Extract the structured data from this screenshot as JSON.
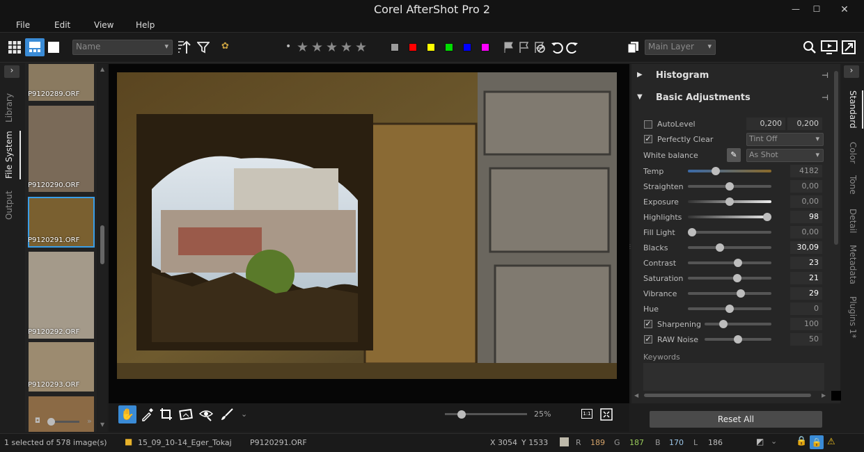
{
  "app": {
    "title": "Corel AfterShot Pro 2"
  },
  "menu": [
    "File",
    "Edit",
    "View",
    "Help"
  ],
  "toolbar": {
    "sort_value": "Name",
    "layer_value": "Main Layer",
    "rating_dot": "•"
  },
  "color_labels": [
    "#9a9a9a",
    "#ff0000",
    "#ffff00",
    "#00dd00",
    "#0000ff",
    "#ff00ff"
  ],
  "left_tabs": [
    "Library",
    "File System",
    "Output"
  ],
  "thumbnails": [
    {
      "label": "P9120289.ORF",
      "color": "#8a7a60"
    },
    {
      "label": "P9120290.ORF",
      "color": "#7a6a58"
    },
    {
      "label": "P9120291.ORF",
      "color": "#7a6030",
      "selected": true
    },
    {
      "label": "P9120292.ORF",
      "color": "#a49a8a"
    },
    {
      "label": "P9120293.ORF",
      "color": "#9c8b70"
    },
    {
      "label": "",
      "color": "#8b6a45"
    }
  ],
  "panel": {
    "histogram_title": "Histogram",
    "basic_title": "Basic Adjustments",
    "autolevel": {
      "label": "AutoLevel",
      "v1": "0,200",
      "v2": "0,200",
      "checked": false
    },
    "perfectly_clear": {
      "label": "Perfectly Clear",
      "option": "Tint Off",
      "checked": true
    },
    "white_balance": {
      "label": "White balance",
      "option": "As Shot"
    },
    "sliders": [
      {
        "label": "Temp",
        "value": "4182",
        "pos": 0.33
      },
      {
        "label": "Straighten",
        "value": "0,00",
        "pos": 0.5
      },
      {
        "label": "Exposure",
        "value": "0,00",
        "pos": 0.5
      },
      {
        "label": "Highlights",
        "value": "98",
        "pos": 0.95
      },
      {
        "label": "Fill Light",
        "value": "0,00",
        "pos": 0.05
      },
      {
        "label": "Blacks",
        "value": "30,09",
        "pos": 0.38
      },
      {
        "label": "Contrast",
        "value": "23",
        "pos": 0.6
      },
      {
        "label": "Saturation",
        "value": "21",
        "pos": 0.59
      },
      {
        "label": "Vibrance",
        "value": "29",
        "pos": 0.63
      },
      {
        "label": "Hue",
        "value": "0",
        "pos": 0.5
      }
    ],
    "sharpening": {
      "label": "Sharpening",
      "value": "100",
      "checked": true,
      "pos": 0.28
    },
    "raw_noise": {
      "label": "RAW Noise",
      "value": "50",
      "checked": true,
      "pos": 0.5
    },
    "keywords_label": "Keywords",
    "reset_label": "Reset All"
  },
  "right_tabs": [
    "Standard",
    "Color",
    "Tone",
    "Detail",
    "Metadata",
    "Plugins 1*"
  ],
  "viewer": {
    "zoom": "25%",
    "zoom_pos": 0.2
  },
  "status": {
    "selected": "1 selected of 578 image(s)",
    "folder": "15_09_10-14_Eger_Tokaj",
    "file": "P9120291.ORF",
    "x": "X 3054",
    "y": "Y 1533",
    "r_label": "R",
    "r": "189",
    "g_label": "G",
    "g": "187",
    "b_label": "B",
    "b": "170",
    "l_label": "L",
    "l": "186"
  }
}
